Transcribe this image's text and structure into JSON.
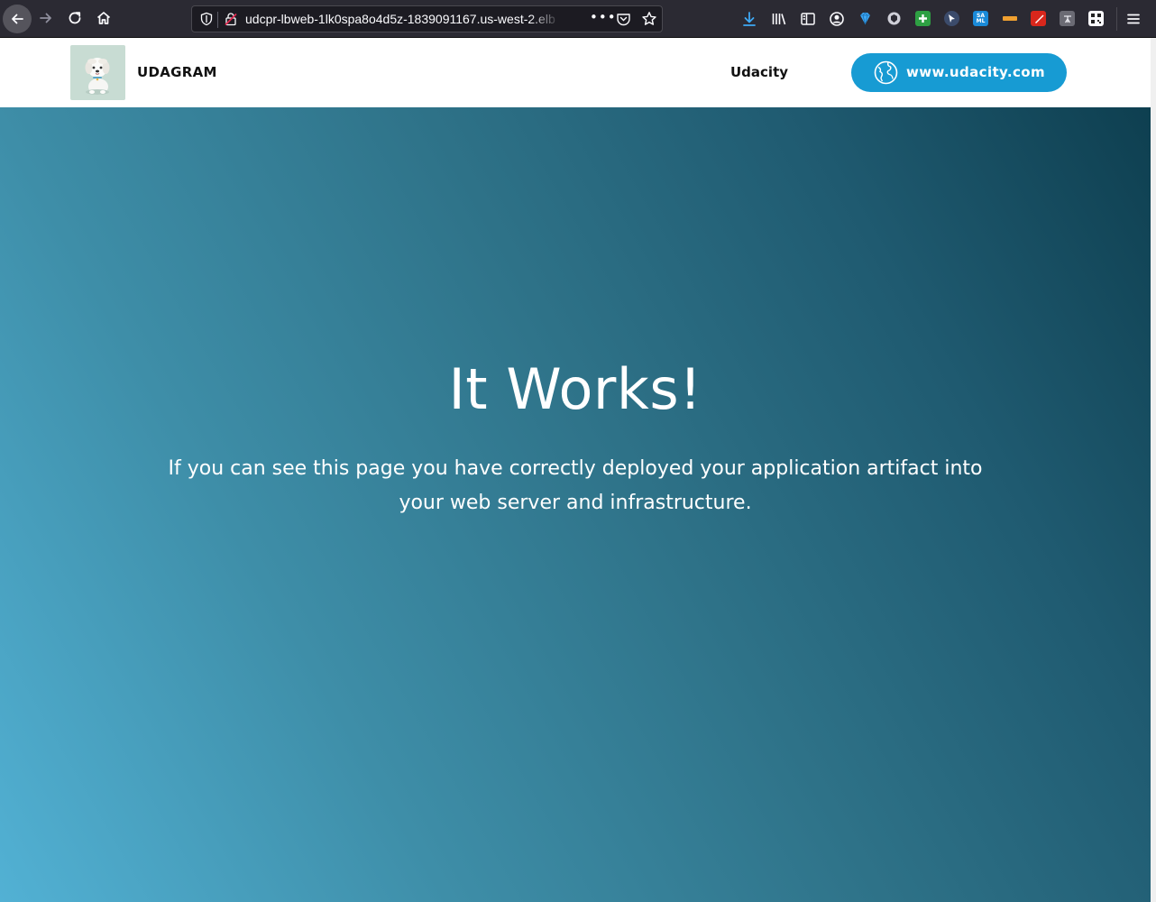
{
  "browser": {
    "url": "udcpr-lbweb-1lk0spa8o4d5z-1839091167.us-west-2.elb",
    "toolbar_icons": [
      "back-icon",
      "forward-icon",
      "reload-icon",
      "home-icon",
      "tracking-shield-icon",
      "insecure-lock-icon",
      "page-actions-icon",
      "pocket-icon",
      "bookmark-star-icon",
      "downloads-icon",
      "library-icon",
      "sidebar-icon",
      "account-icon",
      "app-menu-icon"
    ],
    "colors": {
      "toolbar": "#2b2a33",
      "download_accent": "#3ea9f5"
    }
  },
  "header": {
    "brand": "UDAGRAM",
    "nav_link": "Udacity",
    "site_button": "www.udacity.com",
    "colors": {
      "button": "#179bd3"
    }
  },
  "hero": {
    "title": "It Works!",
    "text": "If you can see this page you have correctly deployed your application artifact into your web server and infrastructure.",
    "colors": {
      "gradient_start": "#52b1d4",
      "gradient_end": "#0e3f50"
    }
  }
}
